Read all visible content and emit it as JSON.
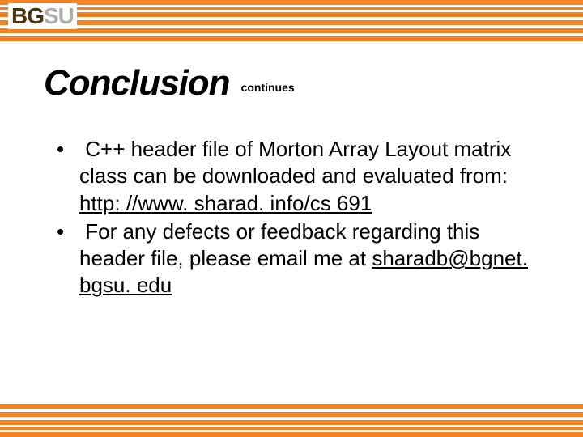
{
  "logo": {
    "primary": "BG",
    "secondary": "SU"
  },
  "title": "Conclusion",
  "title_suffix": "continues",
  "bullets": [
    {
      "text_pre": "C++ header file of Morton Array Layout matrix class can be downloaded and evaluated from: ",
      "link": "http: //www. sharad. info/cs 691",
      "text_post": ""
    },
    {
      "text_pre": "For any defects or feedback regarding this header file, please email me at ",
      "link": "sharadb@bgnet. bgsu. edu",
      "text_post": ""
    }
  ]
}
